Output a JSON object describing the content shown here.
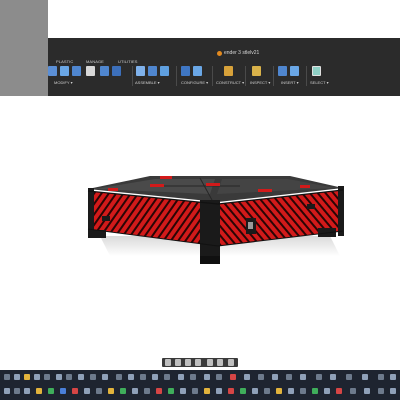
{
  "window": {
    "doc_title": "ender 3 stlelv21"
  },
  "ribbon": {
    "tabs": [
      {
        "label": "PLASTIC"
      },
      {
        "label": "MANAGE"
      },
      {
        "label": "UTILITIES"
      }
    ],
    "groups": [
      {
        "label": "MODIFY ▾"
      },
      {
        "label": "ASSEMBLE ▾"
      },
      {
        "label": "CONFIGURE ▾"
      },
      {
        "label": "CONSTRUCT ▾"
      },
      {
        "label": "INSPECT ▾"
      },
      {
        "label": "INSERT ▾"
      },
      {
        "label": "SELECT ▾"
      }
    ]
  },
  "colors": {
    "model_red": "#d21a1a",
    "model_black": "#1a1a1a",
    "chrome": "#2b2b2b",
    "taskbar": "#1e2430"
  },
  "icons": {
    "nav_toolbar": [
      "orbit-icon",
      "pan-icon",
      "zoom-icon",
      "fit-icon",
      "display-settings-icon",
      "grid-icon",
      "viewports-icon"
    ]
  }
}
